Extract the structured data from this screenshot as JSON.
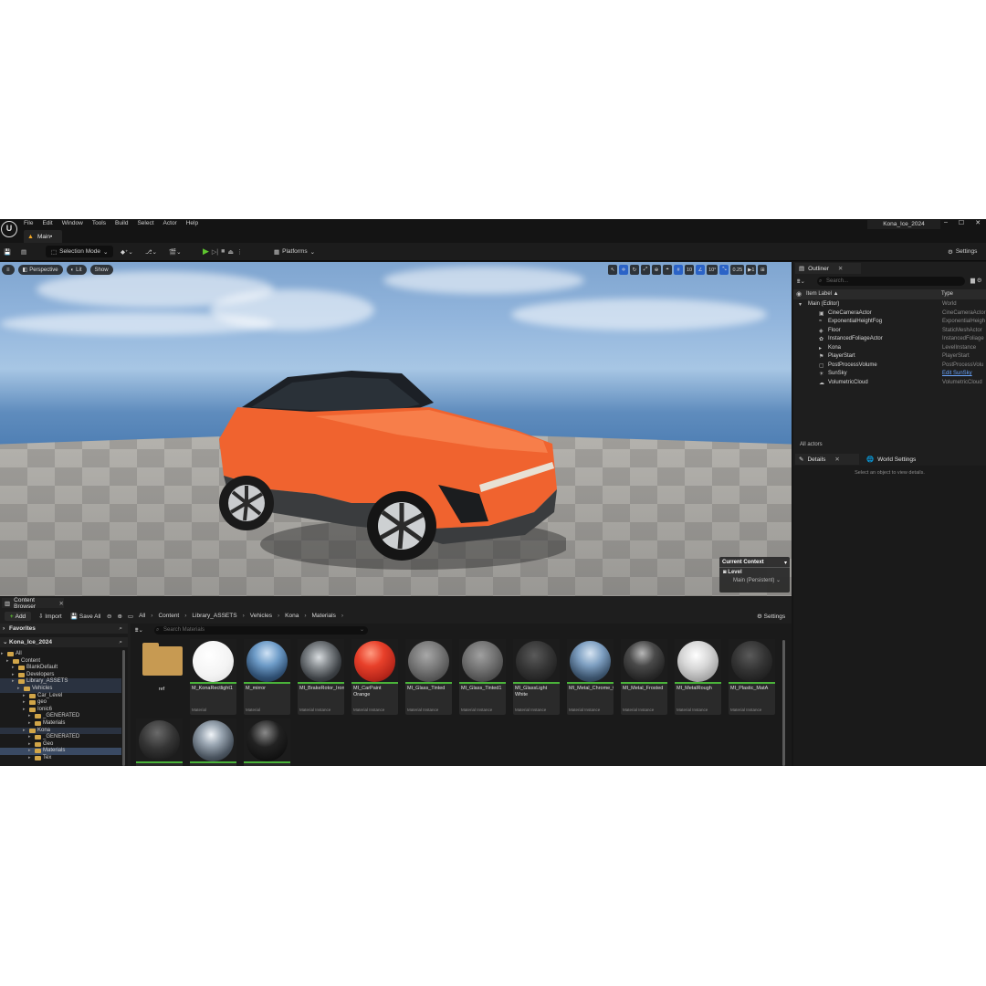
{
  "menu": [
    "File",
    "Edit",
    "Window",
    "Tools",
    "Build",
    "Select",
    "Actor",
    "Help"
  ],
  "doc_tab": "Main•",
  "project_name": "Kona_Ice_2024",
  "toolbar": {
    "selection_mode": "Selection Mode",
    "platforms": "Platforms",
    "settings": "Settings"
  },
  "viewport": {
    "perspective": "Perspective",
    "lit": "Lit",
    "show": "Show",
    "grid_snap": "10",
    "rot_snap": "10°",
    "scale_snap": "0.25",
    "cam_speed": "1",
    "context_title": "Current Context",
    "context_level": "Level",
    "context_selected": "Main (Persistent)"
  },
  "outliner": {
    "tab": "Outliner",
    "search_placeholder": "Search...",
    "col_label": "Item Label ▲",
    "col_type": "Type",
    "rows": [
      {
        "name": "Main (Editor)",
        "type": "World",
        "indent": 16,
        "icon": "▾"
      },
      {
        "name": "CineCameraActor",
        "type": "CineCameraActor",
        "indent": 38,
        "icon": "▣"
      },
      {
        "name": "ExponentialHeightFog",
        "type": "ExponentialHeigh",
        "indent": 38,
        "icon": "≈"
      },
      {
        "name": "Floor",
        "type": "StaticMeshActor",
        "indent": 38,
        "icon": "◈"
      },
      {
        "name": "InstancedFoliageActor",
        "type": "InstancedFoliage",
        "indent": 38,
        "icon": "✿"
      },
      {
        "name": "Kona",
        "type": "LevelInstance",
        "indent": 38,
        "icon": "▸"
      },
      {
        "name": "PlayerStart",
        "type": "PlayerStart",
        "indent": 38,
        "icon": "⚑"
      },
      {
        "name": "PostProcessVolume",
        "type": "PostProcessVolu",
        "indent": 38,
        "icon": "▢"
      },
      {
        "name": "SunSky",
        "type": "Edit SunSky",
        "indent": 38,
        "icon": "☀"
      },
      {
        "name": "VolumetricCloud",
        "type": "VolumetricCloud",
        "indent": 38,
        "icon": "☁"
      }
    ],
    "actor_count": "All actors"
  },
  "details": {
    "tab": "Details",
    "world_tab": "World Settings",
    "hint": "Select an object to view details."
  },
  "content_browser": {
    "tab": "Content Browser",
    "add": "Add",
    "import": "Import",
    "save_all": "Save All",
    "crumbs": [
      "All",
      "Content",
      "Library_ASSETS",
      "Vehicles",
      "Kona",
      "Materials"
    ],
    "settings": "Settings",
    "favorites": "Favorites",
    "project": "Kona_Ice_2024",
    "search_placeholder": "Search Materials",
    "tree": [
      {
        "label": "All",
        "indent": 8,
        "folder": true,
        "state": ""
      },
      {
        "label": "Content",
        "indent": 14,
        "folder": true,
        "state": ""
      },
      {
        "label": "BlankDefault",
        "indent": 20,
        "folder": true,
        "state": ""
      },
      {
        "label": "Developers",
        "indent": 20,
        "folder": true,
        "state": ""
      },
      {
        "label": "Library_ASSETS",
        "indent": 20,
        "folder": true,
        "state": "hl"
      },
      {
        "label": "Vehicles",
        "indent": 26,
        "folder": true,
        "state": "hl"
      },
      {
        "label": "Car_Level",
        "indent": 32,
        "folder": true,
        "state": ""
      },
      {
        "label": "geo",
        "indent": 32,
        "folder": true,
        "state": ""
      },
      {
        "label": "Ionic6",
        "indent": 32,
        "folder": true,
        "state": ""
      },
      {
        "label": "_GENERATED",
        "indent": 38,
        "folder": true,
        "state": ""
      },
      {
        "label": "Materials",
        "indent": 38,
        "folder": true,
        "state": ""
      },
      {
        "label": "Kona",
        "indent": 32,
        "folder": true,
        "state": "hl"
      },
      {
        "label": "_GENERATED",
        "indent": 38,
        "folder": true,
        "state": ""
      },
      {
        "label": "Geo",
        "indent": 38,
        "folder": true,
        "state": ""
      },
      {
        "label": "Materials",
        "indent": 38,
        "folder": true,
        "state": "sel"
      },
      {
        "label": "Tex",
        "indent": 38,
        "folder": true,
        "state": ""
      }
    ],
    "assets": [
      {
        "name": "ref",
        "kind": "",
        "folder": true
      },
      {
        "name": "M_KonaRectlight1",
        "kind": "Material",
        "sphere": "radial-gradient(circle at 40% 35%, #ffffff 0%, #f4f4f4 55%, #dadada 100%)"
      },
      {
        "name": "M_mirror",
        "kind": "Material",
        "sphere": "radial-gradient(circle at 50% 30%, #cfe2f5 0%, #6e9cc8 35%, #2f4f72 70%, #1c2a3b 100%)"
      },
      {
        "name": "MI_BrakeRotor_Iron",
        "kind": "Material Instance",
        "sphere": "radial-gradient(circle at 45% 40%, #d9dde0 0%, #8a8f93 30%, #3b3f43 65%, #1c1e20 100%)"
      },
      {
        "name": "MI_CarPaint Orange",
        "kind": "Material Instance",
        "sphere": "radial-gradient(circle at 40% 30%, #ff9a80 0%, #e8402a 35%, #b7261a 70%, #6a120b 100%)"
      },
      {
        "name": "MI_Glass_Tinted",
        "kind": "Material Instance",
        "sphere": "radial-gradient(circle at 45% 35%, #a8a8a8 0%, #7a7a7a 40%, #4e4e4e 75%, #333 100%)"
      },
      {
        "name": "MI_Glass_Tinted1",
        "kind": "Material Instance",
        "sphere": "radial-gradient(circle at 45% 35%, #a0a0a0 0%, #747474 40%, #4a4a4a 75%, #303030 100%)"
      },
      {
        "name": "MI_GlassLight White",
        "kind": "Material Instance",
        "sphere": "radial-gradient(circle at 45% 35%, #5a5a5a 0%, #353535 45%, #1e1e1e 80%, #141414 100%)"
      },
      {
        "name": "MI_Metal_Chrome_02",
        "kind": "Material Instance",
        "sphere": "radial-gradient(circle at 50% 30%, #d6e4f2 0%, #7fa0c2 35%, #3b536c 70%, #1f2a36 100%)"
      },
      {
        "name": "MI_Metal_Frosted",
        "kind": "Material Instance",
        "sphere": "radial-gradient(circle at 45% 30%, #b8b8b8 0%, #4a4a4a 35%, #262626 70%, #121212 100%)"
      },
      {
        "name": "MI_MetalRough",
        "kind": "Material Instance",
        "sphere": "radial-gradient(circle at 45% 35%, #ffffff 0%, #d6d6d6 40%, #9a9a9a 80%, #6a6a6a 100%)"
      },
      {
        "name": "MI_Plastic_MatA",
        "kind": "Material Instance",
        "sphere": "radial-gradient(circle at 45% 35%, #5a5a5a 0%, #333 45%, #1a1a1a 85%, #0e0e0e 100%)"
      },
      {
        "name": "",
        "kind": "",
        "sphere": "radial-gradient(circle at 45% 30%, #6a6a6a 0%, #343434 45%, #161616 85%, #0a0a0a 100%)"
      },
      {
        "name": "",
        "kind": "",
        "sphere": "radial-gradient(circle at 45% 35%, #f0f4f8 0%, #9aa6b2 30%, #4b5560 65%, #1f2429 100%)"
      },
      {
        "name": "",
        "kind": "",
        "sphere": "radial-gradient(circle at 45% 30%, #8a8a8a 0%, #222 40%, #0e0e0e 80%, #050505 100%)"
      }
    ]
  }
}
